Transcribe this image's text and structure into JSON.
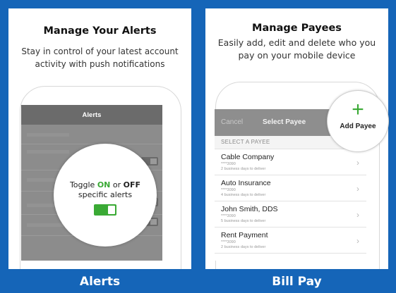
{
  "alerts_panel": {
    "title": "Manage Your Alerts",
    "subtitle": "Stay in control of your latest account activity with push notifications",
    "screen_header": "Alerts",
    "toggle_prefix": "Toggle ",
    "toggle_on": "ON",
    "toggle_or": " or ",
    "toggle_off": "OFF",
    "toggle_line2": "specific alerts",
    "caption": "Alerts",
    "toggle_state": "on"
  },
  "billpay_panel": {
    "title": "Manage Payees",
    "subtitle": "Easily add, edit and delete who you pay on your mobile device",
    "cancel": "Cancel",
    "select_payee": "Select Payee",
    "section": "SELECT A PAYEE",
    "add_plus": "+",
    "add_label": "Add Payee",
    "caption": "Bill Pay",
    "payees": [
      {
        "name": "Cable Company",
        "acct": "****3090",
        "meta": "2 business days to deliver"
      },
      {
        "name": "Auto Insurance",
        "acct": "****3090",
        "meta": "4 business days to deliver"
      },
      {
        "name": "John Smith, DDS",
        "acct": "****3090",
        "meta": "5 business days to deliver"
      },
      {
        "name": "Rent Payment",
        "acct": "****3090",
        "meta": "2 business days to deliver"
      }
    ]
  },
  "colors": {
    "background_blue": "#1565b8",
    "toggle_green": "#3aaa35"
  }
}
